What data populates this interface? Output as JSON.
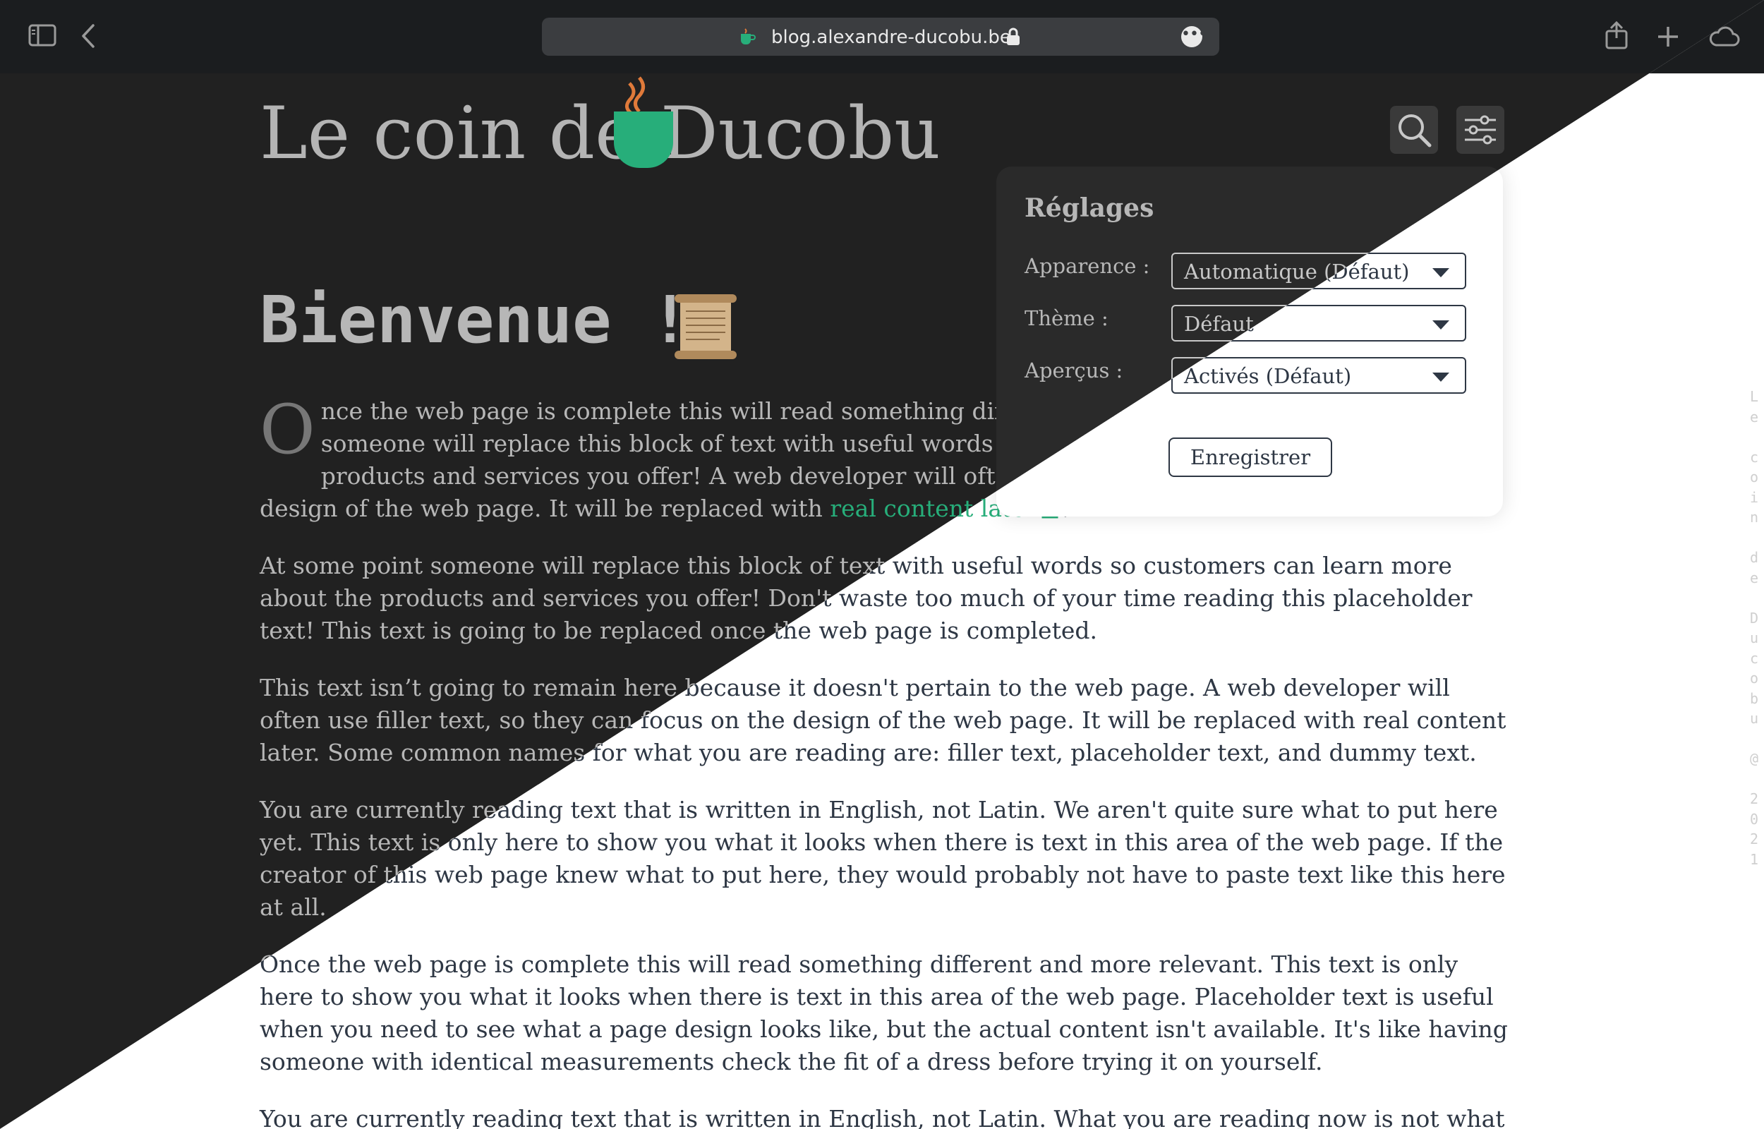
{
  "browser": {
    "url": "blog.alexandre-ducobu.be",
    "more_label": "•••"
  },
  "site": {
    "logo_text": "Le coin de Ducobu",
    "accent_color": "#27ae7a"
  },
  "article": {
    "title": "Bienvenue !",
    "p1_dropcap": "O",
    "p1_text": "nce the web page is complete this will read something different and more relevant. At some point someone will replace this block of text with useful words so customers can learn more about the products and services you offer! A web developer will often use filler text, so they can focus on the design of the web page. It will be replaced with ",
    "p1_link": "real content later",
    "p1_end": ".",
    "p2": "At some point someone will replace this block of text with useful words so customers can learn more about the products and services you offer! Don't waste too much of your time reading this placeholder text! This text is going to be replaced once the web page is completed.",
    "p3": "This text isn’t going to remain here because it doesn't pertain to the web page. A web developer will often use filler text, so they can focus on the design of the web page. It will be replaced with real content later. Some common names for what you are reading are: filler text, placeholder text, and dummy text.",
    "p4": "You are currently reading text that is written in English, not Latin. We aren't quite sure what to put here yet. This text is only here to show you what it looks when there is text in this area of the web page. If the creator of this web page knew what to put here, they would probably not have to paste text like this here at all.",
    "p5": "Once the web page is complete this will read something different and more relevant. This text is only here to show you what it looks when there is text in this area of the web page. Placeholder text is useful when you need to see what a page design looks like, but the actual content isn't available. It's like having someone with identical measurements check the fit of a dress before trying it on yourself.",
    "p6": "You are currently reading text that is written in English, not Latin. What you are reading now is not what"
  },
  "settings": {
    "title": "Réglages",
    "appearance_label": "Apparence :",
    "appearance_value": "Automatique (Défaut)",
    "theme_label": "Thème :",
    "theme_value": "Défaut",
    "previews_label": "Aperçus :",
    "previews_value": "Activés (Défaut)",
    "save_label": "Enregistrer"
  },
  "sidebar_signature": "L\ne\n \nc\no\ni\nn\n \nd\ne\n \nD\nu\nc\no\nb\nu\n \n@\n \n2\n0\n2\n1"
}
